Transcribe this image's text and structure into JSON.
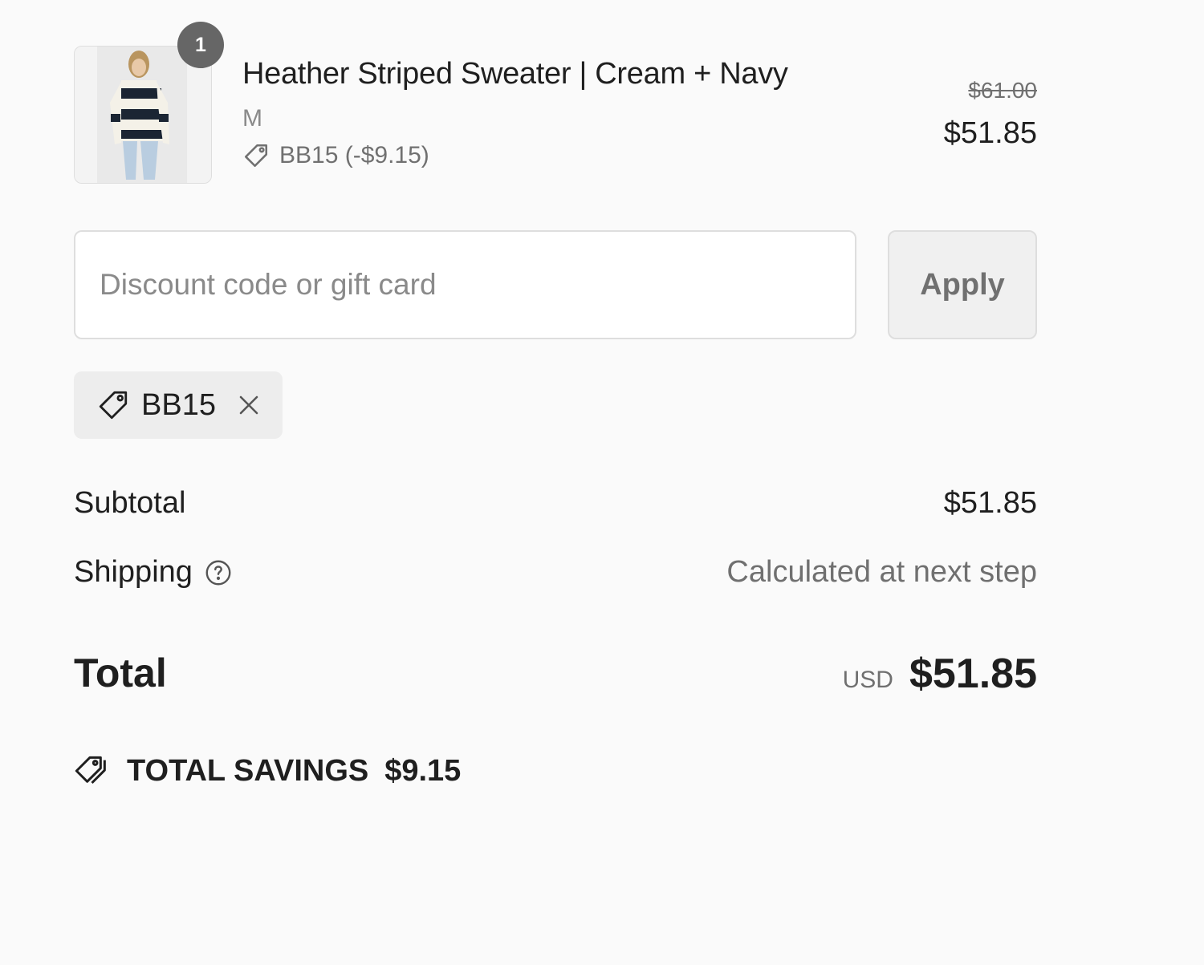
{
  "line_item": {
    "quantity": "1",
    "title": "Heather Striped Sweater | Cream + Navy",
    "variant": "M",
    "discount": "BB15 (-$9.15)",
    "price_original": "$61.00",
    "price_final": "$51.85"
  },
  "discount_form": {
    "placeholder": "Discount code or gift card",
    "value": "",
    "apply_label": "Apply"
  },
  "applied_code": {
    "code": "BB15"
  },
  "totals": {
    "subtotal_label": "Subtotal",
    "subtotal_value": "$51.85",
    "shipping_label": "Shipping",
    "shipping_value": "Calculated at next step",
    "total_label": "Total",
    "currency": "USD",
    "total_value": "$51.85",
    "savings_label": "TOTAL SAVINGS",
    "savings_value": "$9.15"
  },
  "icons": {
    "discount_tag": "tag-icon",
    "remove_code": "close-icon",
    "shipping_help": "question-circle-icon",
    "savings": "tags-icon",
    "product_image": "sweater-photo"
  },
  "colors": {
    "background": "#fafafa",
    "text": "#1f1f1f",
    "muted_text": "#707070",
    "badge": "#666666",
    "border": "#dedede",
    "chip_background": "#ededed"
  }
}
